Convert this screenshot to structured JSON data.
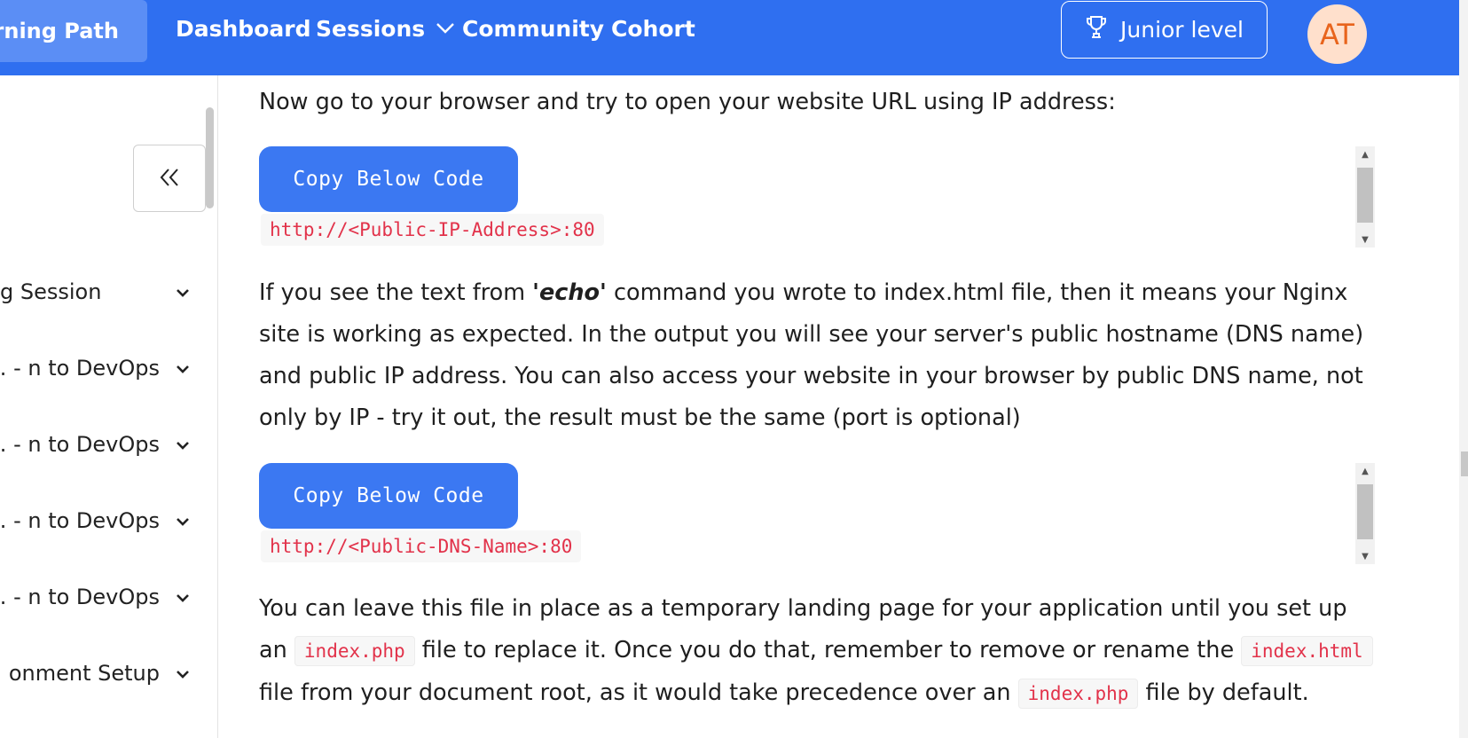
{
  "nav": {
    "active": "arning Path",
    "links": [
      "Dashboard",
      "Sessions",
      "Community",
      "Cohort"
    ],
    "sessions_chevron": "chevron-down-icon",
    "level_label": "Junior level",
    "level_icon": "trophy-icon",
    "avatar_initials": "AT",
    "color_primary": "#2f6ff0"
  },
  "sidebar": {
    "collapse_icon": "double-chevron-left-icon",
    "items": [
      {
        "label": "g Session"
      },
      {
        "label": "n to DevOps - ..."
      },
      {
        "label": "n to DevOps - ..."
      },
      {
        "label": "n to DevOps - ..."
      },
      {
        "label": "n to DevOps - ..."
      },
      {
        "label": "onment Setup ..."
      }
    ]
  },
  "content": {
    "p1": "Now go to your browser and try to open your website URL using IP address:",
    "copy_label": "Copy Below Code",
    "code1": "http://<Public-IP-Address>:80",
    "p2_before": "If you see the text from ",
    "p2_em": "'echo'",
    "p2_after": " command you wrote to index.html file, then it means your Nginx site is working as expected. In the output you will see your server's public hostname (DNS name) and public IP address. You can also access your website in your browser by public DNS name, not only by IP - try it out, the result must be the same (port is optional)",
    "code2": "http://<Public-DNS-Name>:80",
    "p3_a": "You can leave this file in place as a temporary landing page for your application until you set up an ",
    "p3_code1": "index.php",
    "p3_b": " file to replace it. Once you do that, remember to remove or rename the ",
    "p3_code2": "index.html",
    "p3_c": " file from your document root, as it would take precedence over an ",
    "p3_code3": "index.php",
    "p3_d": " file by default."
  }
}
